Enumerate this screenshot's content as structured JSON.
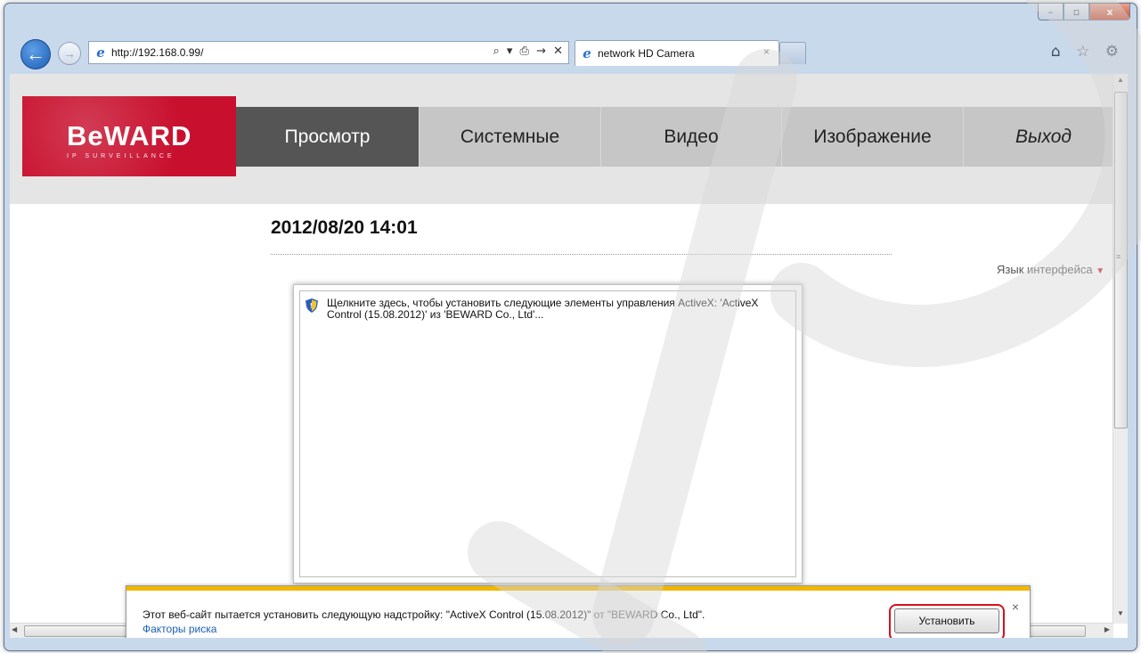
{
  "window": {
    "controls": {
      "minimize": "–",
      "maximize": "▫",
      "close": "x"
    }
  },
  "browser": {
    "address": "http://192.168.0.99/",
    "address_actions": "⌕ ▾ ⎙ → ✕",
    "tab_title": "network HD Camera",
    "tab_close": "×",
    "tools": "⌂ ☆ ⚙",
    "back_glyph": "←",
    "forward_glyph": "→"
  },
  "site": {
    "logo_text": "BeWARD",
    "logo_subtitle": "IP SURVEILLANCE",
    "menu": [
      {
        "label": "Просмотр"
      },
      {
        "label": "Системные"
      },
      {
        "label": "Видео"
      },
      {
        "label": "Изображение"
      },
      {
        "label": "Выход"
      }
    ],
    "datetime": "2012/08/20 14:01",
    "language_label": "Язык интерфейса",
    "language_arrow": "▼",
    "activex_message": "Щелкните здесь, чтобы установить следующие элементы управления ActiveX: 'ActiveX Control (15.08.2012)' из 'BEWARD Co., Ltd'..."
  },
  "notification": {
    "text": "Этот веб-сайт пытается установить следующую надстройку: \"ActiveX Control (15.08.2012)\" от \"BEWARD Co., Ltd\".",
    "link": "Факторы риска",
    "install_label": "Установить",
    "close": "×"
  },
  "scrollbar": {
    "up": "▲",
    "down": "▼",
    "left": "◀",
    "right": "▶",
    "grip": "≡"
  },
  "colors": {
    "brand": "#c8102e",
    "menu_active": "#555555",
    "notification_stripe": "#f2b600",
    "highlight": "#d6111d"
  }
}
